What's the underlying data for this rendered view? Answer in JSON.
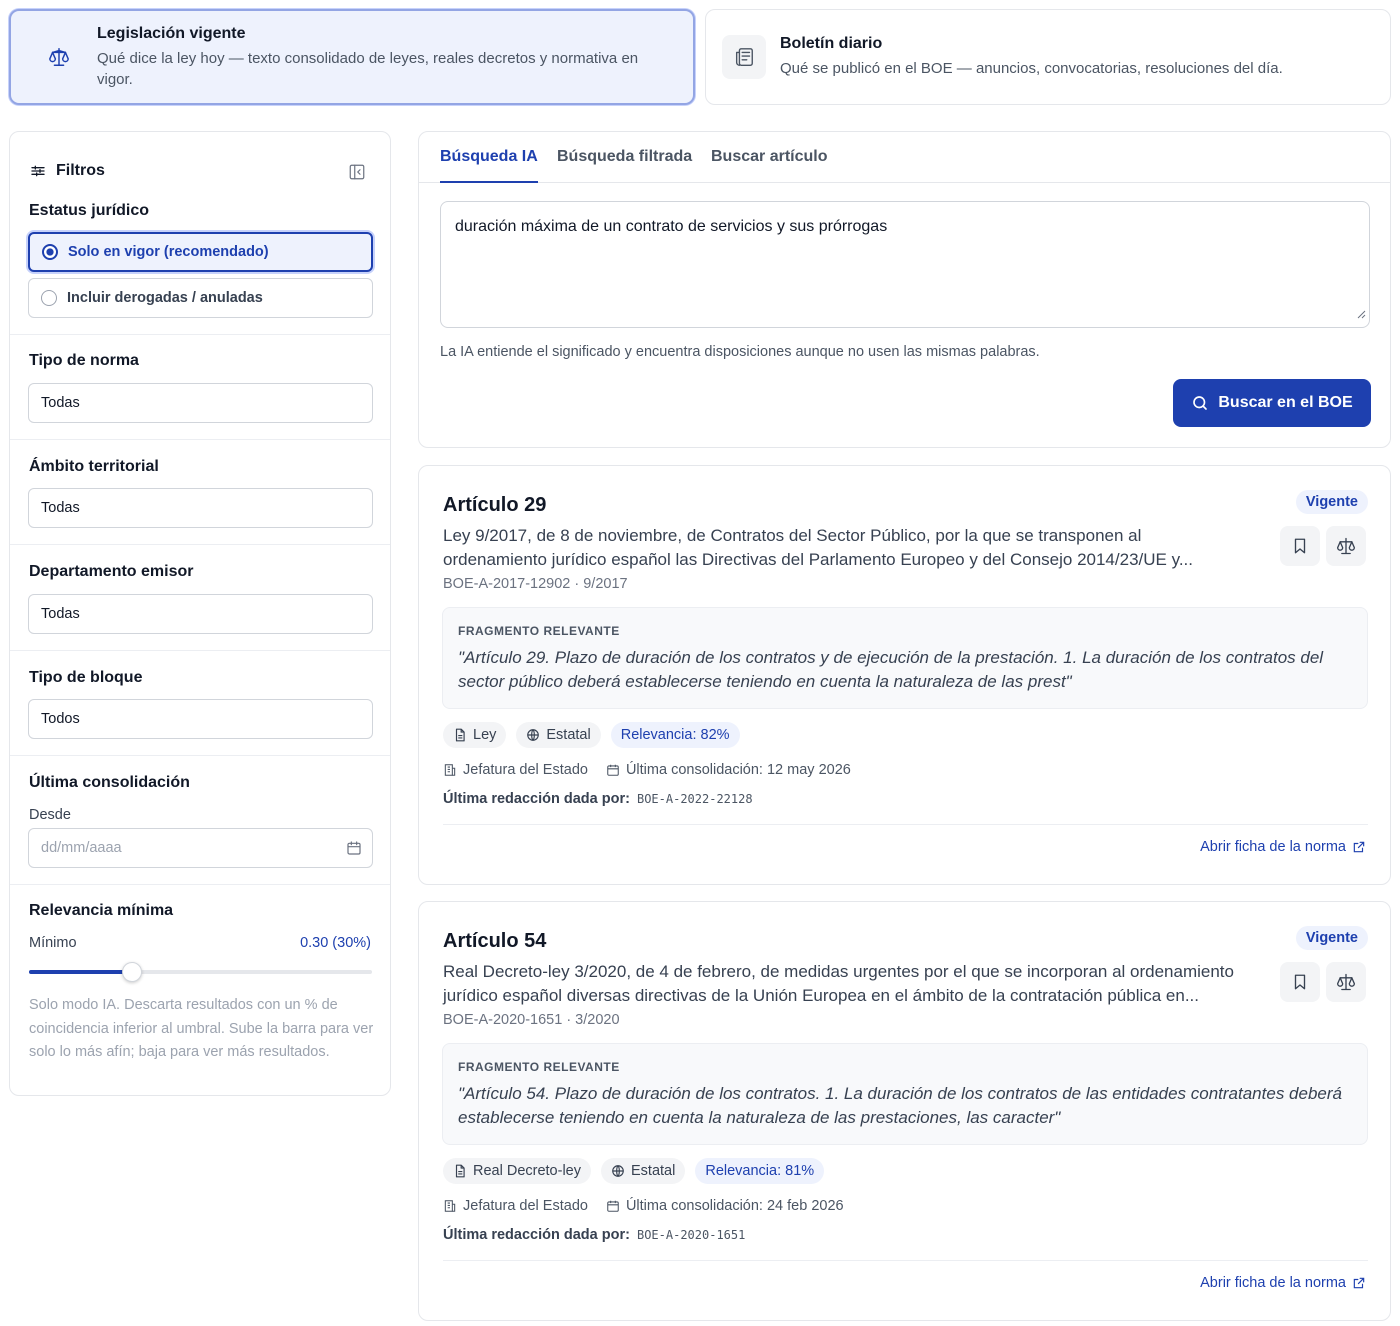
{
  "modes": [
    {
      "title": "Legislación vigente",
      "description": "Qué dice la ley hoy — texto consolidado de leyes, reales decretos y normativa en vigor.",
      "icon": "scale-icon",
      "active": true
    },
    {
      "title": "Boletín diario",
      "description": "Qué se publicó en el BOE — anuncios, convocatorias, resoluciones del día.",
      "icon": "newspaper-icon",
      "active": false
    }
  ],
  "filters": {
    "title": "Filtros",
    "status_label": "Estatus jurídico",
    "status_options": [
      "Solo en vigor (recomendado)",
      "Incluir derogadas / anuladas"
    ],
    "status_selected": 0,
    "norm_type_label": "Tipo de norma",
    "norm_type_value": "Todas",
    "territorial_label": "Ámbito territorial",
    "territorial_value": "Todas",
    "department_label": "Departamento emisor",
    "department_value": "Todas",
    "block_type_label": "Tipo de bloque",
    "block_type_value": "Todos",
    "consolidation_label": "Última consolidación",
    "from_label": "Desde",
    "date_placeholder": "dd/mm/aaaa",
    "relevance_label": "Relevancia mínima",
    "relevance_min_label": "Mínimo",
    "relevance_value_text": "0.30 (30%)",
    "relevance_fraction": 0.3,
    "relevance_help": "Solo modo IA. Descarta resultados con un % de coincidencia inferior al umbral. Sube la barra para ver solo lo más afín; baja para ver más resultados."
  },
  "search": {
    "tabs": [
      "Búsqueda IA",
      "Búsqueda filtrada",
      "Buscar artículo"
    ],
    "active_tab": 0,
    "query": "duración máxima de un contrato de servicios y sus prórrogas",
    "hint": "La IA entiende el significado y encuentra disposiciones aunque no usen las mismas palabras.",
    "button_label": "Buscar en el BOE"
  },
  "results": [
    {
      "title": "Artículo 29",
      "status": "Vigente",
      "description": "Ley 9/2017, de 8 de noviembre, de Contratos del Sector Público, por la que se transponen al ordenamiento jurídico español las Directivas del Parlamento Europeo y del Consejo 2014/23/UE y...",
      "reference": "BOE-A-2017-12902 · 9/2017",
      "fragment_label": "FRAGMENTO RELEVANTE",
      "fragment": "\"Artículo 29. Plazo de duración de los contratos y de ejecución de la prestación. 1. La duración de los contratos del sector público deberá establecerse teniendo en cuenta la naturaleza de las prest\"",
      "chip_type": "Ley",
      "chip_scope": "Estatal",
      "chip_relevance": "Relevancia: 82%",
      "department": "Jefatura del Estado",
      "consolidation": "Última consolidación: 12 may 2026",
      "last_red_label": "Última redacción dada por:",
      "last_red_code": "BOE-A-2022-22128",
      "link": "Abrir ficha de la norma"
    },
    {
      "title": "Artículo 54",
      "status": "Vigente",
      "description": "Real Decreto-ley 3/2020, de 4 de febrero, de medidas urgentes por el que se incorporan al ordenamiento jurídico español diversas directivas de la Unión Europea en el ámbito de la contratación pública en...",
      "reference": "BOE-A-2020-1651 · 3/2020",
      "fragment_label": "FRAGMENTO RELEVANTE",
      "fragment": "\"Artículo 54. Plazo de duración de los contratos. 1. La duración de los contratos de las entidades contratantes deberá establecerse teniendo en cuenta la naturaleza de las prestaciones, las caracter\"",
      "chip_type": "Real Decreto-ley",
      "chip_scope": "Estatal",
      "chip_relevance": "Relevancia: 81%",
      "department": "Jefatura del Estado",
      "consolidation": "Última consolidación: 24 feb 2026",
      "last_red_label": "Última redacción dada por:",
      "last_red_code": "BOE-A-2020-1651",
      "link": "Abrir ficha de la norma"
    }
  ],
  "colors": {
    "accent": "#1e40af",
    "accent_light": "#eef2fd",
    "border": "#e5e7eb"
  }
}
